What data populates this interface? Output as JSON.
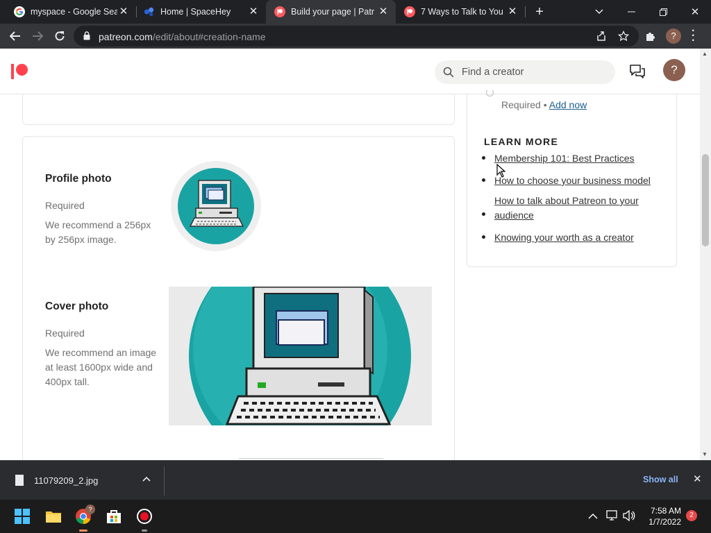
{
  "browser": {
    "tabs": [
      {
        "title": "myspace - Google Sear",
        "icon": "google-icon"
      },
      {
        "title": "Home | SpaceHey",
        "icon": "spacehey-icon"
      },
      {
        "title": "Build your page | Patre",
        "icon": "patreon-icon",
        "active": true
      },
      {
        "title": "7 Ways to Talk to Your",
        "icon": "patreon-icon"
      }
    ],
    "url_domain": "patreon.com",
    "url_path": "/edit/about#creation-name"
  },
  "header": {
    "search_placeholder": "Find a creator",
    "help_label": "?"
  },
  "profile_photo": {
    "title": "Profile photo",
    "required": "Required",
    "description": "We recommend a 256px by 256px image."
  },
  "cover_photo": {
    "title": "Cover photo",
    "required": "Required",
    "description": "We recommend an image at least 1600px wide and 400px tall."
  },
  "sidebar": {
    "required_text": "Required •",
    "add_now": "Add now",
    "learn_more_title": "LEARN MORE",
    "links": [
      "Membership 101: Best Practices",
      "How to choose your business model",
      "How to talk about Patreon to your audience",
      "Knowing your worth as a creator"
    ]
  },
  "downloads": {
    "file_name": "11079209_2.jpg",
    "show_all": "Show all"
  },
  "taskbar": {
    "time": "7:58 AM",
    "date": "1/7/2022",
    "notification_count": "2",
    "chrome_badge": "?"
  },
  "colors": {
    "patreon_red": "#ff424d",
    "link_blue": "#1a5e8f",
    "teal": "#1aa3a3"
  }
}
